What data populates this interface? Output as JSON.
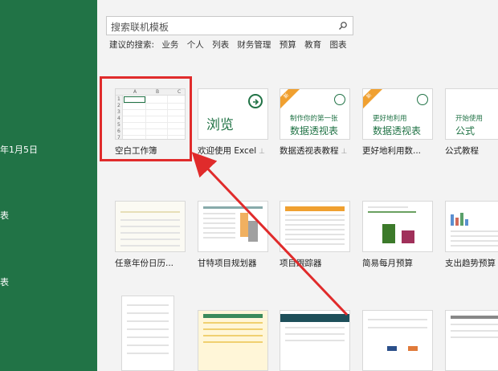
{
  "sidebar": {
    "items": [
      {
        "label": "年1月5日"
      },
      {
        "label": "表"
      },
      {
        "label": "表"
      }
    ]
  },
  "search": {
    "placeholder": "搜索联机模板"
  },
  "suggestions": {
    "label": "建议的搜索:",
    "keywords": [
      "业务",
      "个人",
      "列表",
      "财务管理",
      "预算",
      "教育",
      "图表"
    ]
  },
  "templates": {
    "row1": [
      {
        "caption": "空白工作簿",
        "pinned": false
      },
      {
        "caption": "欢迎使用 Excel",
        "pinned": true,
        "thumb_text": "浏览"
      },
      {
        "caption": "数据透视表教程",
        "pinned": true,
        "ribbon": "新",
        "line1": "制作你的第一张",
        "line2": "数据透视表"
      },
      {
        "caption": "更好地利用数...",
        "pinned": false,
        "ribbon": "新",
        "line1": "更好地利用",
        "line2": "数据透视表"
      },
      {
        "caption": "公式教程",
        "pinned": false,
        "line1": "开始使用",
        "line2": "公式"
      }
    ],
    "row2": [
      {
        "caption": "任意年份日历..."
      },
      {
        "caption": "甘特项目规划器"
      },
      {
        "caption": "项目跟踪器"
      },
      {
        "caption": "简易每月预算"
      },
      {
        "caption": "支出趋势预算"
      }
    ]
  },
  "blank_grid": {
    "columns": [
      "A",
      "B",
      "C"
    ],
    "rows": [
      "1",
      "2",
      "3",
      "4",
      "5",
      "6",
      "7"
    ]
  },
  "colors": {
    "excel_green": "#217346",
    "highlight_red": "#e02b2b",
    "ribbon_orange": "#f0a030"
  }
}
